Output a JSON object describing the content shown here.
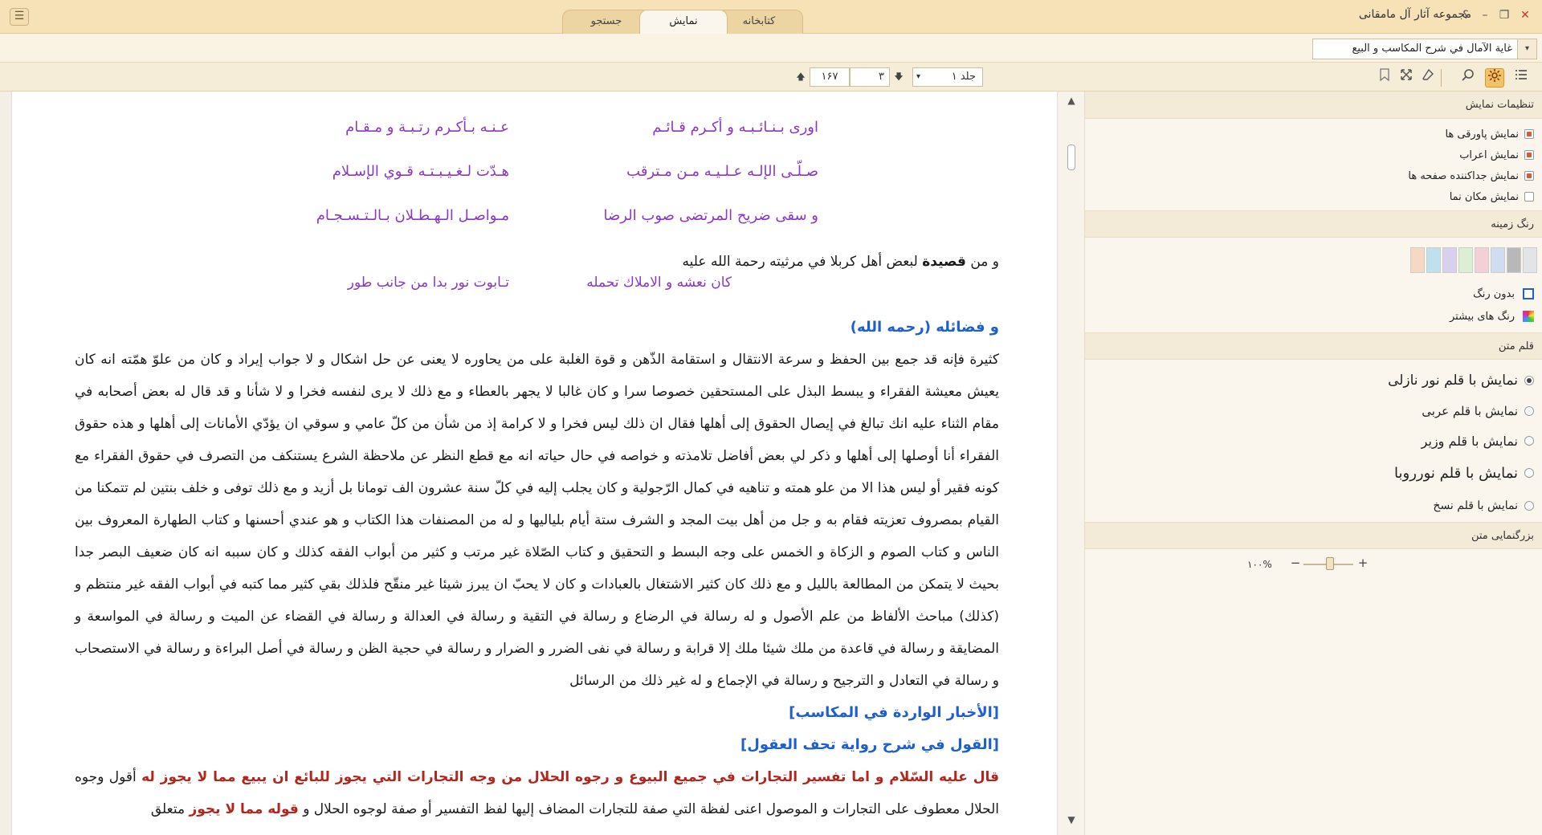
{
  "window": {
    "title": "مجموعه آثار آل مامقانی",
    "help_label": "؟",
    "minimize_label": "–",
    "restore_label": "❐",
    "close_label": "✕",
    "menu_label": "☰"
  },
  "tabs": [
    {
      "label": "کتابخانه"
    },
    {
      "label": "نمایش"
    },
    {
      "label": "جستجو"
    }
  ],
  "book": {
    "selected": "غاية الآمال في شرح المكاسب و البيع",
    "dropdown_icon": "▾"
  },
  "toolbar": {
    "volume_value": "جلد ۱",
    "page_value": "۳",
    "total_pages": "۱۶۷",
    "down_arrow": "🡇",
    "up_arrow": "🡅",
    "dropdown_icon": "▾"
  },
  "content": {
    "poem": [
      {
        "h1": "اوری بـنـائـبـه و أكـرم قـائـم",
        "h2": "عـنـه بـأكـرم رتـبـة و مـقـام"
      },
      {
        "h1": "صـلّـى الإلـه عـلـيـه مـن مـترقب",
        "h2": "هـدّت لـغـيـبـتـه قـوي الإسـلام"
      },
      {
        "h1": "و سقى ضريح المرتضى صوب الرضا",
        "h2": "مـواصـل الـهـطـلان بـالـتـسـجـام"
      }
    ],
    "intro_prefix": "و من",
    "intro_bold": "قصيدة",
    "intro_rest": "لبعض أهل كربلا في مرثيته رحمة الله عليه",
    "couplet": {
      "h1": "كان نعشه و الاملاك تحمله",
      "h2": "تـابوت نور بدا من جانب طور"
    },
    "virtues_heading": "و فضائله (رحمه الله)",
    "virtues_text": "كثيرة فإنه قد جمع بين الحفظ و سرعة الانتقال و استقامة الذّهن و قوة الغلبة على من يحاوره لا يعنى عن حل اشكال و لا جواب إيراد و كان من علوّ همّته انه كان يعيش معيشة الفقراء و يبسط البذل على المستحقين خصوصا سرا و كان غالبا لا يجهر بالعطاء و مع ذلك لا يرى لنفسه فخرا و لا شأنا و قد قال له بعض أصحابه في مقام الثناء عليه انك تبالغ في إيصال الحقوق إلى أهلها فقال ان ذلك ليس فخرا و لا كرامة إذ من شأن من كلّ عامي و سوقي ان يؤدّي الأمانات إلى أهلها و هذه حقوق الفقراء أنا أوصلها إلى أهلها و ذكر لي بعض أفاضل تلامذته و خواصه في حال حياته انه مع قطع النظر عن ملاحظة الشرع يستنكف من التصرف في حقوق الفقراء مع كونه فقير أو ليس هذا الا من علو همته و تناهيه في كمال الرّجولية و كان يجلب إليه في كلّ سنة عشرون الف تومانا بل أزيد و مع ذلك توفى و خلف بنتين لم تتمكنا من القيام بمصروف تعزيته فقام به و جل من أهل بيت المجد و الشرف ستة أيام بلياليها و له من المصنفات هذا الكتاب و هو عندي أحسنها و كتاب الطهارة المعروف بين الناس و كتاب الصوم و الزكاة و الخمس على وجه البسط و التحقيق و كتاب الصّلاة غير مرتب و كثير من أبواب الفقه كذلك و كان سببه انه كان ضعيف البصر جدا بحيث لا يتمكن من المطالعة بالليل و مع ذلك كان كثير الاشتغال بالعبادات و كان لا يحبّ ان يبرز شيئا غير منقّح فلذلك بقي كثير مما كتبه في أبواب الفقه غير منتظم و (كذلك) مباحث الألفاظ من علم الأصول و له رسالة في الرضاع و رسالة في التقية و رسالة في العدالة و رسالة في القضاء عن الميت و رسالة في المواسعة و المضايقة و رسالة في قاعدة من ملك شيئا ملك إلا قرابة و رسالة في نفى الضرر و الضرار و رسالة في حجية الظن و رسالة في أصل البراءة و رسالة في الاستصحاب و رسالة في التعادل و الترجيح و رسالة في الإجماع و له غير ذلك من الرسائل",
    "heading_2": "[الأخبار الواردة في المكاسب]",
    "heading_3": "[القول في شرح رواية تحف العقول]",
    "quote_red_1": "قال عليه السّلام و اما تفسير التجارات في جميع البيوع و رجوه الحلال من وجه التجارات التي يجوز للبائع ان يبيع مما لا يجوز له",
    "quote_black_1": "أقول وجوه الحلال معطوف على التجارات و الموصول اعنى لفظة التي صفة للتجارات المضاف إليها لفظ التفسير أو صفة لوجوه الحلال و",
    "quote_red_2": "قوله مما لا يجوز",
    "quote_black_2": "متعلق"
  },
  "panel": {
    "display_settings": {
      "title": "تنظيمات نمایش",
      "items": [
        {
          "label": "نمایش پاورقی ها",
          "checked": true
        },
        {
          "label": "نمایش اعراب",
          "checked": true
        },
        {
          "label": "نمایش جداکننده صفحه ها",
          "checked": true
        },
        {
          "label": "نمایش مکان نما",
          "checked": false
        }
      ]
    },
    "bg_color": {
      "title": "رنگ زمینه",
      "swatches": [
        "#f6d9c3",
        "#bfe0ee",
        "#d9cfee",
        "#dcefd5",
        "#f3cfd6",
        "#cfdcf1",
        "#b8b8b8",
        "#e2e4e8"
      ],
      "no_color_label": "بدون رنگ",
      "more_colors_label": "رنگ های بیشتر"
    },
    "font": {
      "title": "قلم متن",
      "options": [
        {
          "label": "نمایش با قلم نور نازلی",
          "selected": true
        },
        {
          "label": "نمایش با قلم عربی",
          "selected": false
        },
        {
          "label": "نمایش با قلم وزیر",
          "selected": false
        },
        {
          "label": "نمایش با قلم نورروبا",
          "selected": false
        },
        {
          "label": "نمایش با قلم نسخ",
          "selected": false
        }
      ]
    },
    "zoom": {
      "title": "بزرگنمایی متن",
      "value_label": "۱۰۰%",
      "minus": "−",
      "plus": "+",
      "level_percent": 100
    }
  },
  "colors": {
    "accent": "#f2c16b",
    "titlebar": "#f7e2b8",
    "poem": "#8a37c5",
    "heading_blue": "#1d5fd0",
    "quote_red": "#b3261e"
  }
}
